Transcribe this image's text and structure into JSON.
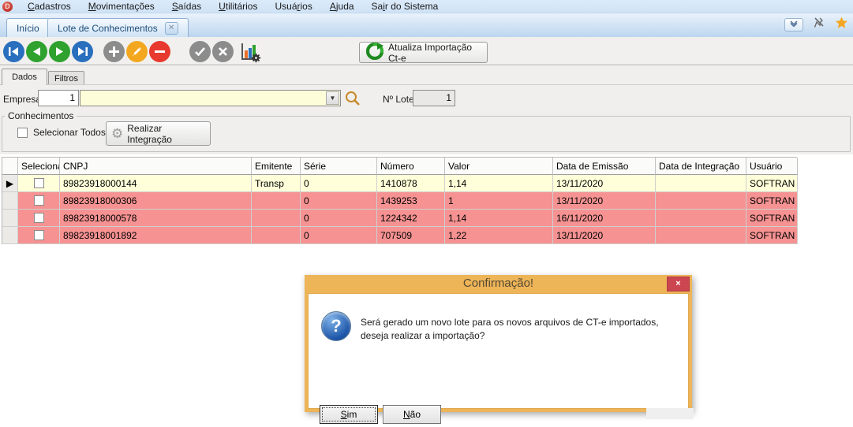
{
  "app": {
    "logo_letter": "D",
    "menu_items": [
      {
        "pre": "",
        "key": "C",
        "post": "adastros"
      },
      {
        "pre": "",
        "key": "M",
        "post": "ovimentações"
      },
      {
        "pre": "",
        "key": "S",
        "post": "aídas"
      },
      {
        "pre": "",
        "key": "U",
        "post": "tilitários"
      },
      {
        "pre": "Usuá",
        "key": "r",
        "post": "ios"
      },
      {
        "pre": "",
        "key": "A",
        "post": "juda"
      },
      {
        "pre": "Sa",
        "key": "i",
        "post": "r do Sistema"
      }
    ]
  },
  "doc_tabs": {
    "items": [
      {
        "label": "Início"
      },
      {
        "label": "Lote de Conhecimentos",
        "close_glyph": "✕"
      }
    ],
    "chevron_glyph": "❯"
  },
  "toolbar": {
    "buttons": [
      {
        "name": "first-record"
      },
      {
        "name": "previous-record"
      },
      {
        "name": "next-record"
      },
      {
        "name": "last-record"
      },
      {
        "name": "add-record"
      },
      {
        "name": "edit-record"
      },
      {
        "name": "delete-record"
      },
      {
        "name": "confirm"
      },
      {
        "name": "cancel"
      },
      {
        "name": "report-chart"
      }
    ],
    "update_button_label": "Atualiza Importação Ct-e"
  },
  "page_tabs": {
    "dados": "Dados",
    "filtros": "Filtros"
  },
  "form": {
    "empresa_label": "Empresa",
    "empresa_value": "1",
    "empresa_combo_value": "",
    "lote_label": "Nº Lote",
    "lote_value": "1"
  },
  "conhecimentos": {
    "group_title": "Conhecimentos",
    "select_all_label": "Selecionar Todos",
    "integrate_button_label": "Realizar Integração"
  },
  "grid": {
    "columns": [
      "",
      "Selecionar",
      "CNPJ",
      "Emitente",
      "Série",
      "Número",
      "Valor",
      "Data de Emissão",
      "Data de Integração",
      "Usuário"
    ],
    "rows": [
      {
        "cnpj": "89823918000144",
        "emitente": "Transp",
        "serie": "0",
        "numero": "1410878",
        "valor": "1,14",
        "emissao": "13/11/2020",
        "integracao": "",
        "usuario": "SOFTRAN",
        "state": "current"
      },
      {
        "cnpj": "89823918000306",
        "emitente": "",
        "serie": "0",
        "numero": "1439253",
        "valor": "1",
        "emissao": "13/11/2020",
        "integracao": "",
        "usuario": "SOFTRAN",
        "state": "error"
      },
      {
        "cnpj": "89823918000578",
        "emitente": "",
        "serie": "0",
        "numero": "1224342",
        "valor": "1,14",
        "emissao": "16/11/2020",
        "integracao": "",
        "usuario": "SOFTRAN",
        "state": "error"
      },
      {
        "cnpj": "89823918001892",
        "emitente": "",
        "serie": "0",
        "numero": "707509",
        "valor": "1,22",
        "emissao": "13/11/2020",
        "integracao": "",
        "usuario": "SOFTRAN",
        "state": "error"
      }
    ]
  },
  "dialog": {
    "title": "Confirmação!",
    "close_glyph": "×",
    "message": "Será gerado um novo lote para os novos arquivos de CT-e importados, deseja realizar a importação?",
    "yes": {
      "pre": "",
      "key": "S",
      "post": "im"
    },
    "no": {
      "pre": "",
      "key": "N",
      "post": "ão"
    },
    "question_glyph": "?"
  },
  "colors": {
    "menubar_bg": "#d4e3f5",
    "tabstrip_bg": "#bdd6ef",
    "toolbar_bg": "#f1f0ee",
    "row_current_bg": "#ffffd9",
    "row_error_bg": "#f69292",
    "dialog_frame": "#edb458",
    "dialog_close_red": "#cb4650",
    "nav_blue": "#2a6fbe",
    "nav_green": "#2fa12e",
    "add_gray": "#8c8c8c",
    "edit_amber": "#f2a71f",
    "delete_red": "#e8392e",
    "combo_yellow": "#fdfdd9",
    "star_gold": "#f5a623"
  }
}
